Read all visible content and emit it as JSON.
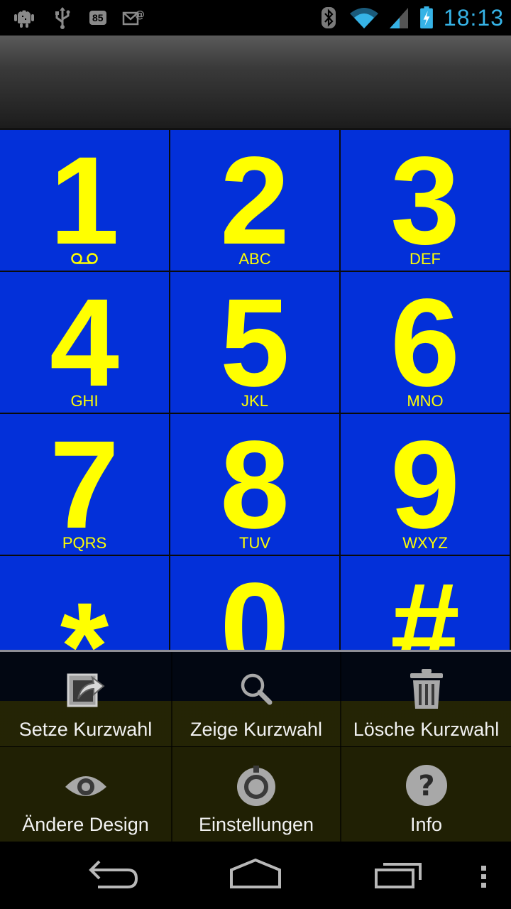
{
  "status_bar": {
    "notification_icons": [
      "android-debug-icon",
      "usb-icon",
      "badge-85",
      "email-icon"
    ],
    "badge_text": "85",
    "system_icons": [
      "bluetooth-icon",
      "wifi-icon",
      "signal-icon",
      "battery-charging-icon"
    ],
    "time": "18:13",
    "time_color": "#36b3e6"
  },
  "keypad": {
    "key_color": "#0330d9",
    "text_color": "#ffff00",
    "keys": [
      {
        "digit": "1",
        "letters": "",
        "icon": "voicemail-icon"
      },
      {
        "digit": "2",
        "letters": "ABC"
      },
      {
        "digit": "3",
        "letters": "DEF"
      },
      {
        "digit": "4",
        "letters": "GHI"
      },
      {
        "digit": "5",
        "letters": "JKL"
      },
      {
        "digit": "6",
        "letters": "MNO"
      },
      {
        "digit": "7",
        "letters": "PQRS"
      },
      {
        "digit": "8",
        "letters": "TUV"
      },
      {
        "digit": "9",
        "letters": "WXYZ"
      },
      {
        "digit": "*",
        "letters": ""
      },
      {
        "digit": "0",
        "letters": ""
      },
      {
        "digit": "#",
        "letters": ""
      }
    ]
  },
  "menu": {
    "items": [
      {
        "label": "Setze Kurzwahl",
        "icon": "set-speed-dial-icon"
      },
      {
        "label": "Zeige Kurzwahl",
        "icon": "search-icon"
      },
      {
        "label": "Lösche Kurzwahl",
        "icon": "trash-icon"
      },
      {
        "label": "Ändere Design",
        "icon": "theme-eye-icon"
      },
      {
        "label": "Einstellungen",
        "icon": "settings-icon"
      },
      {
        "label": "Info",
        "icon": "help-icon"
      }
    ]
  },
  "nav_bar": {
    "buttons": [
      "back-icon",
      "home-icon",
      "recent-apps-icon",
      "overflow-menu-icon"
    ]
  }
}
